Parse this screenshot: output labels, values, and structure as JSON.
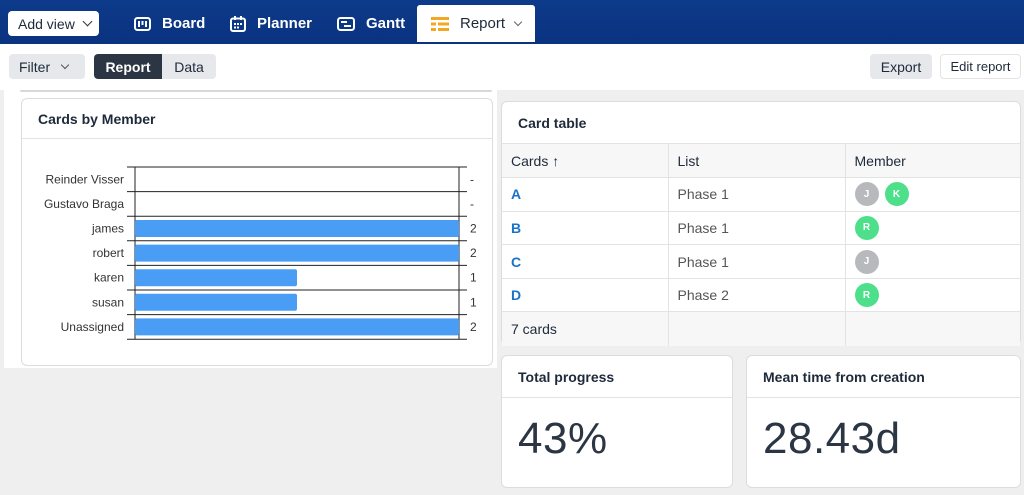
{
  "topbar": {
    "add_view_label": "Add view",
    "tabs": [
      {
        "label": "Board",
        "icon": "board-icon"
      },
      {
        "label": "Planner",
        "icon": "planner-icon"
      },
      {
        "label": "Gantt",
        "icon": "gantt-icon"
      },
      {
        "label": "Report",
        "icon": "report-icon",
        "active": true
      }
    ]
  },
  "toolbar": {
    "filter_label": "Filter",
    "view_toggle": [
      "Report",
      "Data"
    ],
    "active_view": "Report",
    "export_label": "Export",
    "edit_report_label": "Edit report"
  },
  "colors": {
    "topbar": "#0c3785",
    "bar": "#4a9df5",
    "active_segment": "#2c3543",
    "link": "#1a73c9",
    "avatar_j": "#b7b9bd",
    "avatar_green": "#4ddf8a"
  },
  "chart_card": {
    "title": "Cards by Member"
  },
  "chart_data": {
    "type": "bar",
    "orientation": "horizontal",
    "title": "Cards by Member",
    "categories": [
      "Reinder Visser",
      "Gustavo Braga",
      "james",
      "robert",
      "karen",
      "susan",
      "Unassigned"
    ],
    "values": [
      null,
      null,
      2,
      2,
      1,
      1,
      2
    ],
    "value_labels": [
      "-",
      "-",
      "2",
      "2",
      "1",
      "1",
      "2"
    ],
    "xlim": [
      0,
      2
    ],
    "grid": true,
    "legend": "none"
  },
  "table_card": {
    "title": "Card table",
    "columns": [
      "Cards ↑",
      "List",
      "Member"
    ],
    "rows": [
      {
        "card": "A",
        "list": "Phase 1",
        "members": [
          {
            "initial": "J",
            "color": "#b7b9bd"
          },
          {
            "initial": "K",
            "color": "#4ddf8a"
          }
        ]
      },
      {
        "card": "B",
        "list": "Phase 1",
        "members": [
          {
            "initial": "R",
            "color": "#4ddf8a"
          }
        ]
      },
      {
        "card": "C",
        "list": "Phase 1",
        "members": [
          {
            "initial": "J",
            "color": "#b7b9bd"
          }
        ]
      },
      {
        "card": "D",
        "list": "Phase 2",
        "members": [
          {
            "initial": "R",
            "color": "#4ddf8a"
          }
        ]
      }
    ],
    "footer": "7 cards"
  },
  "metrics": [
    {
      "title": "Total progress",
      "value": "43%"
    },
    {
      "title": "Mean time from creation",
      "value": "28.43d"
    }
  ]
}
